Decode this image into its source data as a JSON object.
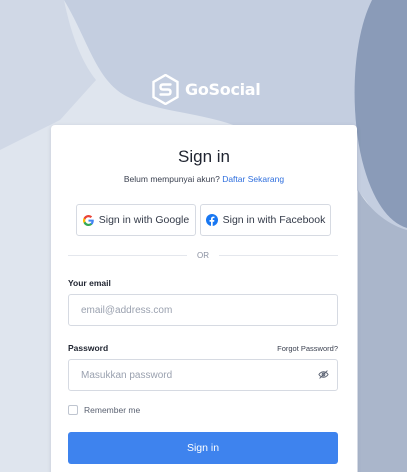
{
  "brand": {
    "name": "GoSocial",
    "icon": "gosocial-logo"
  },
  "card": {
    "title": "Sign in",
    "subline_prefix": "Belum mempunyai akun?",
    "register_link": "Daftar Sekarang"
  },
  "social": {
    "google_label": "Sign in with Google",
    "facebook_label": "Sign in with Facebook",
    "google_icon": "google-icon",
    "facebook_icon": "facebook-icon"
  },
  "divider": {
    "label": "OR"
  },
  "email": {
    "label": "Your email",
    "placeholder": "email@address.com",
    "value": ""
  },
  "password": {
    "label": "Password",
    "forgot_label": "Forgot Password?",
    "placeholder": "Masukkan password",
    "value": "",
    "toggle_icon": "eye-off-icon"
  },
  "remember": {
    "label": "Remember me",
    "checked": false
  },
  "submit": {
    "label": "Sign in"
  },
  "colors": {
    "background": "#dfe5ee",
    "shape_light": "#c4cee0",
    "shape_dark": "#8a9bb8",
    "accent": "#3e83ee",
    "link": "#2f6fde"
  }
}
